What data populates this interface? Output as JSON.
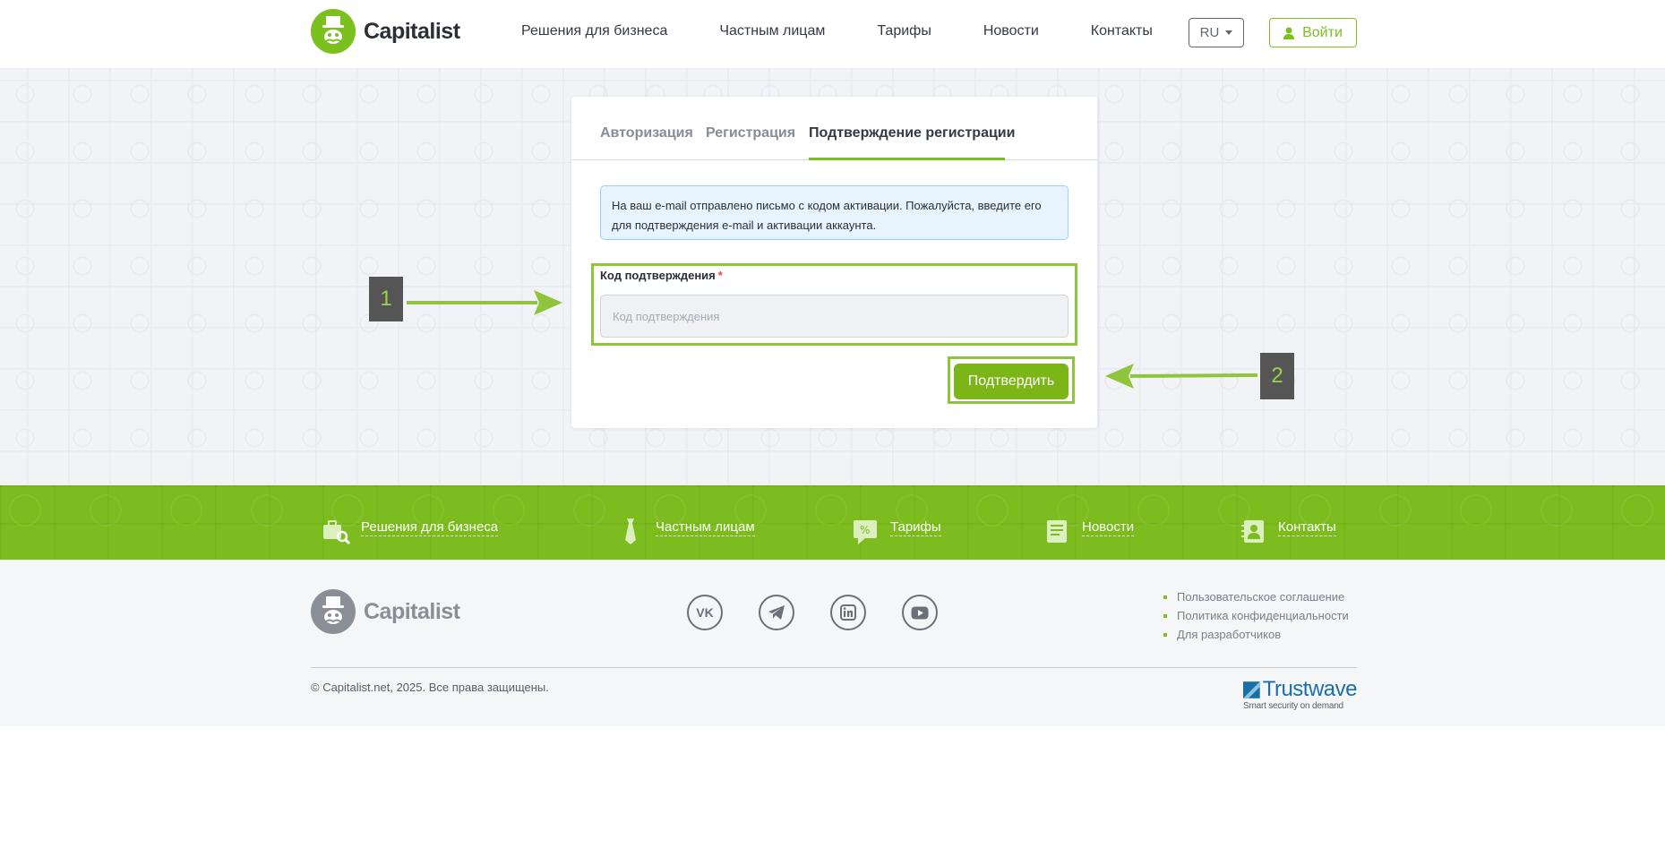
{
  "header": {
    "logo_text": "Capitalist",
    "nav": [
      "Решения для бизнеса",
      "Частным лицам",
      "Тарифы",
      "Новости",
      "Контакты"
    ],
    "lang": "RU",
    "login_label": "Войти"
  },
  "card": {
    "tabs": [
      {
        "label": "Авторизация",
        "active": false
      },
      {
        "label": "Регистрация",
        "active": false
      },
      {
        "label": "Подтверждение регистрации",
        "active": true
      }
    ],
    "alert_text": "На ваш e-mail отправлено письмо с кодом активации. Пожалуйста, введите его для подтверждения e-mail и активации аккаунта.",
    "field_label": "Код подтверждения",
    "required_mark": "*",
    "field_placeholder": "Код подтверждения",
    "field_value": "",
    "confirm_label": "Подтвердить"
  },
  "annotations": {
    "badge_1": "1",
    "badge_2": "2",
    "highlight_color": "#8fc53a"
  },
  "band": {
    "items": [
      {
        "label": "Решения для бизнеса",
        "icon": "business-bag-icon"
      },
      {
        "label": "Частным лицам",
        "icon": "tie-icon"
      },
      {
        "label": "Тарифы",
        "icon": "tariff-tag-icon"
      },
      {
        "label": "Новости",
        "icon": "newspaper-icon"
      },
      {
        "label": "Контакты",
        "icon": "contact-card-icon"
      }
    ]
  },
  "footer": {
    "logo_text": "Capitalist",
    "social": [
      "vk-icon",
      "telegram-icon",
      "linkedin-icon",
      "youtube-icon"
    ],
    "links": [
      "Пользовательское соглашение",
      "Политика конфиденциальности",
      "Для разработчиков"
    ],
    "copyright": "© Capitalist.net, 2025. Все права защищены.",
    "trust_name": "Trustwave",
    "trust_tagline": "Smart security on demand"
  },
  "colors": {
    "brand_green": "#7cc01f",
    "button_green": "#7cb518",
    "band_green": "#7cbc1e",
    "alert_bg": "#e8f4fd",
    "trustwave_blue": "#1a6fa8"
  }
}
